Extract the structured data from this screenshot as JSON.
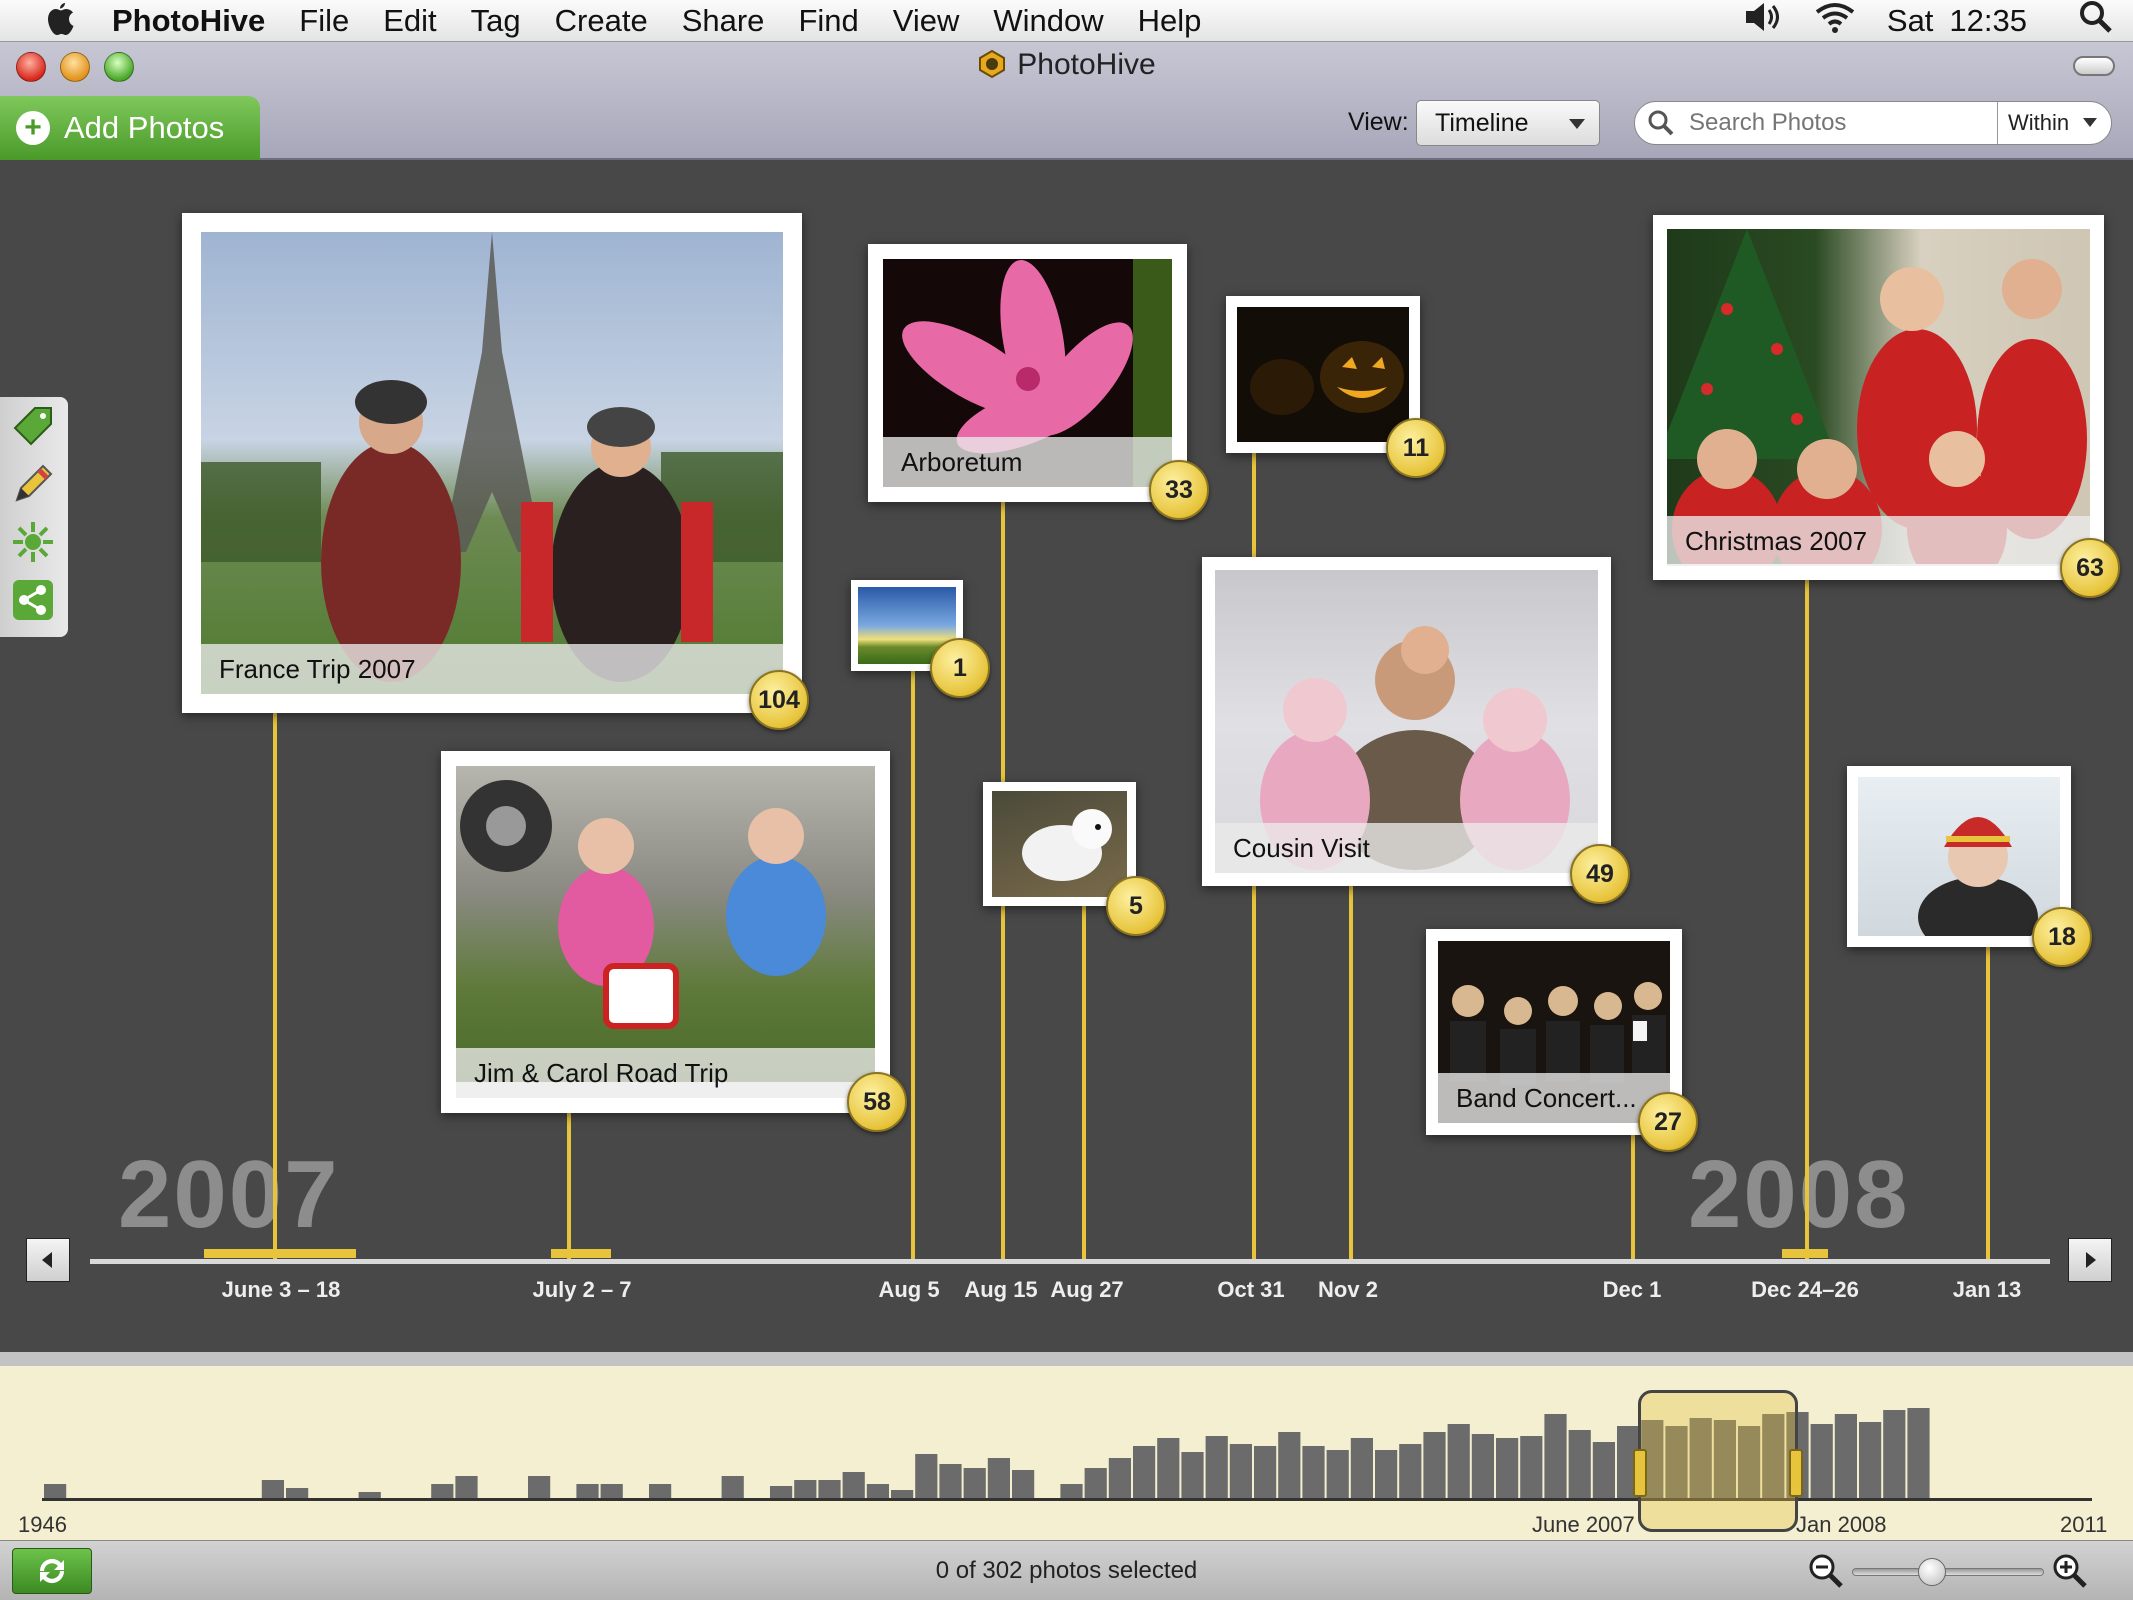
{
  "menubar": {
    "app_name": "PhotoHive",
    "items": [
      "File",
      "Edit",
      "Tag",
      "Create",
      "Share",
      "Find",
      "View",
      "Window",
      "Help"
    ],
    "clock_day": "Sat",
    "clock_time": "12:35"
  },
  "window": {
    "title": "PhotoHive"
  },
  "toolbar": {
    "add_photos_label": "Add Photos",
    "view_label": "View:",
    "view_value": "Timeline",
    "search_placeholder": "Search Photos",
    "within_label": "Within"
  },
  "timeline": {
    "year_left": "2007",
    "year_right": "2008",
    "dates": [
      "June 3 – 18",
      "July 2 – 7",
      "Aug 5",
      "Aug 15",
      "Aug 27",
      "Oct 31",
      "Nov 2",
      "Dec 1",
      "Dec 24–26",
      "Jan 13"
    ],
    "events": [
      {
        "caption": "France Trip 2007",
        "count": "104"
      },
      {
        "caption": "Jim & Carol Road Trip",
        "count": "58"
      },
      {
        "caption": "",
        "count": "1"
      },
      {
        "caption": "Arboretum",
        "count": "33"
      },
      {
        "caption": "",
        "count": "5"
      },
      {
        "caption": "",
        "count": "11"
      },
      {
        "caption": "Cousin Visit",
        "count": "49"
      },
      {
        "caption": "Band Concert...",
        "count": "27"
      },
      {
        "caption": "Christmas 2007",
        "count": "63"
      },
      {
        "caption": "",
        "count": "18"
      }
    ]
  },
  "overview": {
    "start_label": "1946",
    "window_start_label": "June 2007",
    "window_end_label": "Jan 2008",
    "end_label": "2011"
  },
  "status": {
    "selection_text": "0 of 302 photos selected"
  },
  "colors": {
    "accent": "#e7c43b",
    "background": "#484848",
    "green": "#4a9a2a"
  }
}
